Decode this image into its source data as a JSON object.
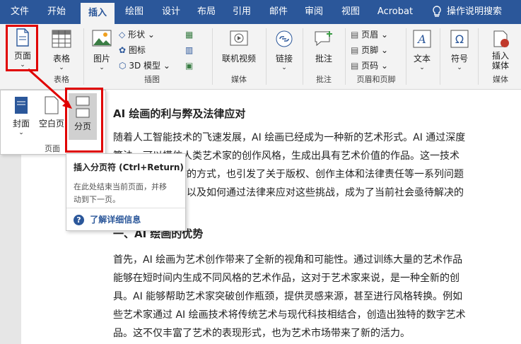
{
  "menubar": {
    "tabs": [
      "文件",
      "开始",
      "插入",
      "绘图",
      "设计",
      "布局",
      "引用",
      "邮件",
      "审阅",
      "视图",
      "Acrobat"
    ],
    "search": "操作说明搜索",
    "active_index": 2
  },
  "ribbon": {
    "pages": {
      "label": "页面"
    },
    "table": {
      "label": "表格",
      "group": "表格"
    },
    "illustrations": {
      "picture": "图片",
      "shapes": "形状",
      "icons": "图标",
      "model3d": "3D 模型",
      "group": "插图"
    },
    "media_online": {
      "label": "联机视频",
      "group": "媒体"
    },
    "links": {
      "label": "链接"
    },
    "comments": {
      "label": "批注",
      "group": "批注"
    },
    "header_footer": {
      "header": "页眉",
      "footer": "页脚",
      "page_number": "页码",
      "group": "页眉和页脚"
    },
    "text": {
      "label": "文本"
    },
    "symbols": {
      "label": "符号"
    },
    "insert_media": {
      "label": "插入\n媒体",
      "group": "媒体"
    }
  },
  "pages_dropdown": {
    "cover": "封面",
    "blank": "空白页",
    "page_break": "分页",
    "group": "页面"
  },
  "tooltip": {
    "title": "插入分页符 (Ctrl+Return)",
    "body1": "在此处结束当前页面，并移",
    "body2": "动到下一页。",
    "link": "了解详细信息"
  },
  "document": {
    "title": "AI 绘画的利与弊及法律应对",
    "p1_l1": "随着人工智能技术的飞速发展，AI 绘画已经成为一种新的艺术形式。AI 通过深度",
    "p1_l2": "算法，可以模仿人类艺术家的创作风格，生成出具有艺术价值的作品。这一技术",
    "p1_l3": "作的方式，也引发了关于版权、创作主体和法律责任等一系列问题",
    "p1_l4": "，以及如何通过法律来应对这些挑战，成为了当前社会亟待解决的",
    "heading1": "一、AI 绘画的优势",
    "p2_l1": "首先，AI 绘画为艺术创作带来了全新的视角和可能性。通过训练大量的艺术作品",
    "p2_l2": "能够在短时间内生成不同风格的艺术作品，这对于艺术家来说，是一种全新的创",
    "p2_l3": "具。AI 能够帮助艺术家突破创作瓶颈，提供灵感来源，甚至进行风格转换。例如",
    "p2_l4": "些艺术家通过 AI 绘画技术将传统艺术与现代科技相结合，创造出独特的数字艺术",
    "p2_l5": "品。这不仅丰富了艺术的表现形式，也为艺术市场带来了新的活力。"
  },
  "colors": {
    "brand": "#2b579a",
    "highlight": "#e00000",
    "link": "#2b579a"
  }
}
